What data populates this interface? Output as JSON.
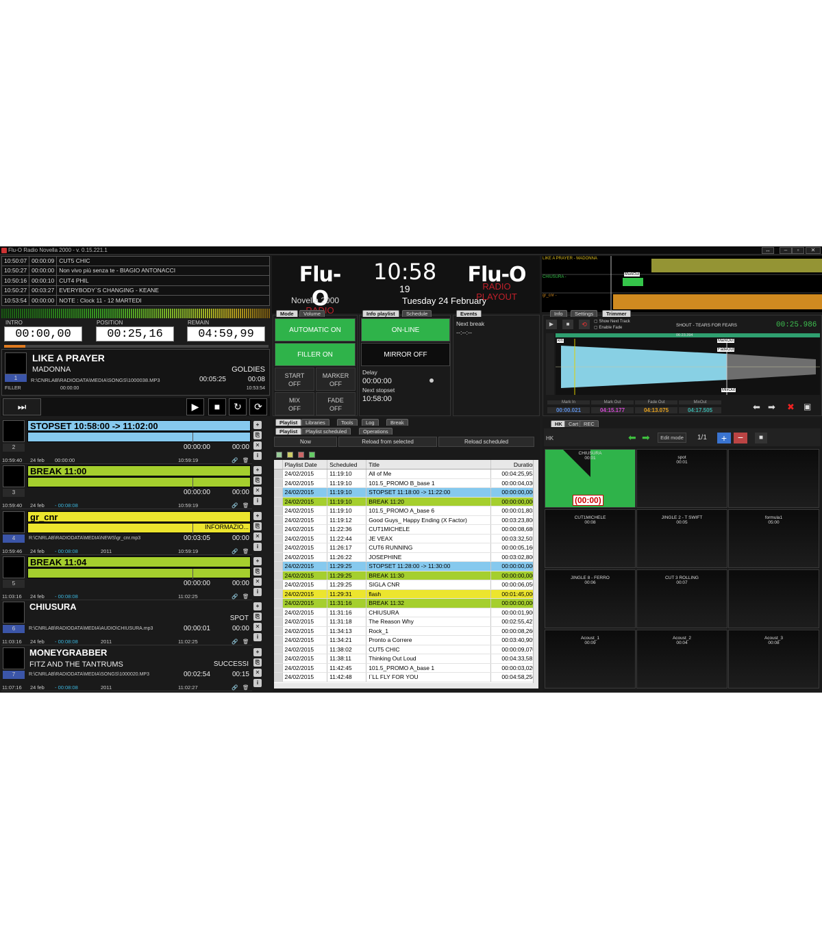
{
  "window": {
    "title": "Flu-O Radio Novella 2000 - v. 0.15.221.1"
  },
  "history": [
    {
      "time": "10:50:07",
      "dur": "00:00:09",
      "title": "CUT5 CHIC"
    },
    {
      "time": "10:50:27",
      "dur": "00:00:00",
      "title": "Non vivo più senza te - BIAGIO ANTONACCI"
    },
    {
      "time": "10:50:16",
      "dur": "00:00:10",
      "title": "CUT4 PHIL"
    },
    {
      "time": "10:50:27",
      "dur": "00:03:27",
      "title": "EVERYBODY`S CHANGING - KEANE"
    },
    {
      "time": "10:53:54",
      "dur": "00:00:00",
      "title": "NOTE : Clock 11 - 12   MARTEDI"
    }
  ],
  "counters": {
    "intro_label": "INTRO",
    "intro": "00:00,00",
    "position_label": "POSITION",
    "position": "00:25,16",
    "remain_label": "REMAIN",
    "remain": "04:59,99",
    "progress": 0.08
  },
  "current": {
    "title": "LIKE A PRAYER",
    "artist": "MADONNA",
    "category": "GOLDIES",
    "num": "1",
    "path": "R:\\CNRLAB\\RADIODATA\\MEDIA\\SONGS\\1000038.MP3",
    "duration": "00:05:25",
    "intro": "00:08",
    "type": "FILLER",
    "time1": "00:00:00",
    "time2": "10:53:54"
  },
  "queue": [
    {
      "num": "2",
      "title": "STOPSET 10:58:00 -> 11:02:00",
      "color": "#86c9ee",
      "bar": "#86c9ee",
      "dur": "00:00:00",
      "intro": "00:00",
      "path": "",
      "cat": "",
      "foot_time": "10:59:40",
      "foot_date": "24 feb",
      "foot_dur": "00:00:00",
      "foot_year": "",
      "foot_end": "10:59:19"
    },
    {
      "num": "3",
      "title": "BREAK 11:00",
      "color": "#a5cf2e",
      "bar": "#a5cf2e",
      "dur": "00:00:00",
      "intro": "00:00",
      "path": "",
      "cat": "",
      "foot_time": "10:59:40",
      "foot_date": "24 feb",
      "foot_dur": "- 00:08:08",
      "foot_year": "",
      "foot_end": "10:59:19"
    },
    {
      "num": "4",
      "title": "gr_cnr",
      "color": "#ece52e",
      "bar": "#ece52e",
      "dur": "00:03:05",
      "intro": "00:00",
      "path": "R:\\CNRLAB\\RADIODATA\\MEDIA\\NEWS\\gr_cnr.mp3",
      "cat": "INFORMAZIO...",
      "foot_time": "10:59:46",
      "foot_date": "24 feb",
      "foot_dur": "- 00:08:08",
      "foot_year": "2011",
      "foot_end": "10:59:19"
    },
    {
      "num": "5",
      "title": "BREAK 11:04",
      "color": "#a5cf2e",
      "bar": "#a5cf2e",
      "dur": "00:00:00",
      "intro": "00:00",
      "path": "",
      "cat": "",
      "foot_time": "11:03:16",
      "foot_date": "24 feb",
      "foot_dur": "- 00:08:08",
      "foot_year": "",
      "foot_end": "11:02:25"
    },
    {
      "num": "6",
      "title": "CHIUSURA",
      "color": "",
      "bar": "",
      "dur": "00:00:01",
      "intro": "00:00",
      "path": "R:\\CNRLAB\\RADIODATA\\MEDIA\\AUDIO\\CHIUSURA.mp3",
      "cat": "SPOT",
      "foot_time": "11:03:16",
      "foot_date": "24 feb",
      "foot_dur": "- 00:08:08",
      "foot_year": "2011",
      "foot_end": "11:02:25"
    },
    {
      "num": "7",
      "title": "MONEYGRABBER",
      "artist": "FITZ AND THE TANTRUMS",
      "color": "",
      "bar": "",
      "dur": "00:02:54",
      "intro": "00:15",
      "path": "R:\\CNRLAB\\RADIODATA\\MEDIA\\SONGS\\1000020.MP3",
      "cat": "SUCCESSI",
      "foot_time": "11:07:16",
      "foot_date": "24 feb",
      "foot_dur": "- 00:08:08",
      "foot_year": "2011",
      "foot_end": "11:02:27"
    }
  ],
  "header": {
    "logo": "Flu-O",
    "logo_sub": "RADIO PLAYOUT",
    "station": "Novella 2000",
    "clock": "10:58",
    "seconds": "19",
    "date": "Tuesday 24  February"
  },
  "mode": {
    "tabs": [
      "Mode",
      "Volume"
    ],
    "automatic": "AUTOMATIC ON",
    "filler": "FILLER ON",
    "start": "START",
    "start_state": "OFF",
    "marker": "MARKER",
    "marker_state": "OFF",
    "mix": "MIX",
    "mix_state": "OFF",
    "fade": "FADE",
    "fade_state": "OFF"
  },
  "info": {
    "tabs": [
      "Info playlist",
      "Schedule"
    ],
    "online": "ON-LINE",
    "mirror": "MIRROR OFF",
    "delay_label": "Delay",
    "delay": "00:00:00",
    "next_label": "Next stopset",
    "next": "10:58:00"
  },
  "events": {
    "tab": "Events",
    "next_break": "Next break",
    "value": "--:--:--"
  },
  "wave_top": {
    "l1": "LIKE A PRAYER - MADONNA",
    "l2": "CHIUSURA -",
    "l3": "gr_cnr -",
    "mark": "MarkOut"
  },
  "trimmer": {
    "tabs": [
      "Info",
      "Settings",
      "Trimmer"
    ],
    "opt1": "Show Next Track",
    "opt2": "Enable Fade",
    "track": "SHOUT - TEARS FOR FEARS",
    "time": "00:25.986",
    "mid_time": "06:23.394",
    "kin": "kIn",
    "markout": "MarkOut",
    "fadeout": "FadeOut",
    "mixout": "MixOut",
    "marks": [
      {
        "label": "Mark In",
        "value": "00:00.021",
        "color": "#5b8de0"
      },
      {
        "label": "Mark Out",
        "value": "04:15.177",
        "color": "#d04ad0"
      },
      {
        "label": "Fade Out",
        "value": "04:13.075",
        "color": "#e6a21e"
      },
      {
        "label": "MixOut",
        "value": "04:17.505",
        "color": "#39b0a8"
      }
    ]
  },
  "lists": {
    "tabs": [
      "Playlist",
      "Libraries",
      "Tools",
      "Log",
      "Break"
    ],
    "subtabs": [
      "Playlist",
      "Playlist scheduled",
      "Operations"
    ],
    "now": "Now",
    "reload_sel": "Reload from selected",
    "reload_sch": "Reload scheduled",
    "cols": [
      "Playlist Date",
      "Scheduled",
      "Title",
      "Duration"
    ],
    "rows": [
      [
        "24/02/2015",
        "11:19:10",
        "All of Me",
        "00:04:25,953",
        ""
      ],
      [
        "24/02/2015",
        "11:19:10",
        "101.5_PROMO B_base 1",
        "00:00:04,030",
        ""
      ],
      [
        "24/02/2015",
        "11:19:10",
        "STOPSET 11:18:00 -> 11:22:00",
        "00:00:00,000",
        "#86c9ee"
      ],
      [
        "24/02/2015",
        "11:19:10",
        "BREAK 11:20",
        "00:00:00,000",
        "#a5cf2e"
      ],
      [
        "24/02/2015",
        "11:19:10",
        "101.5_PROMO A_base 6",
        "00:00:01,803",
        ""
      ],
      [
        "24/02/2015",
        "11:19:12",
        "Good Guys_ Happy Ending (X Factor)",
        "00:03:23,800",
        ""
      ],
      [
        "24/02/2015",
        "11:22:36",
        "CUT1MICHELE",
        "00:00:08,680",
        ""
      ],
      [
        "24/02/2015",
        "11:22:44",
        "JE VEAX",
        "00:03:32,507",
        ""
      ],
      [
        "24/02/2015",
        "11:26:17",
        "CUT6 RUNNING",
        "00:00:05,160",
        ""
      ],
      [
        "24/02/2015",
        "11:26:22",
        "JOSEPHINE",
        "00:03:02,800",
        ""
      ],
      [
        "24/02/2015",
        "11:29:25",
        "STOPSET 11:28:00 -> 11:30:00",
        "00:00:00,000",
        "#86c9ee"
      ],
      [
        "24/02/2015",
        "11:29:25",
        "BREAK 11:30",
        "00:00:00,000",
        "#a5cf2e"
      ],
      [
        "24/02/2015",
        "11:29:25",
        "SIGLA CNR",
        "00:00:06,050",
        ""
      ],
      [
        "24/02/2015",
        "11:29:31",
        "flash",
        "00:01:45,000",
        "#ece52e"
      ],
      [
        "24/02/2015",
        "11:31:16",
        "BREAK 11:32",
        "00:00:00,000",
        "#a5cf2e"
      ],
      [
        "24/02/2015",
        "11:31:16",
        "CHIUSURA",
        "00:00:01,900",
        ""
      ],
      [
        "24/02/2015",
        "11:31:18",
        "The Reason Why",
        "00:02:55,427",
        ""
      ],
      [
        "24/02/2015",
        "11:34:13",
        "Rock_1",
        "00:00:08,260",
        ""
      ],
      [
        "24/02/2015",
        "11:34:21",
        "Pronto a Correre",
        "00:03:40,909",
        ""
      ],
      [
        "24/02/2015",
        "11:38:02",
        "CUT5 CHIC",
        "00:00:09,070",
        ""
      ],
      [
        "24/02/2015",
        "11:38:11",
        "Thinking Out Loud",
        "00:04:33,581",
        ""
      ],
      [
        "24/02/2015",
        "11:42:45",
        "101.5_PROMO A_base 1",
        "00:00:03,020",
        ""
      ],
      [
        "24/02/2015",
        "11:42:48",
        "I`LL FLY FOR YOU",
        "00:04:58,256",
        ""
      ]
    ]
  },
  "carts": {
    "tabs": [
      "HK",
      "Cart",
      "REC"
    ],
    "label": "HK",
    "edit": "Edit mode",
    "page": "1/1",
    "items": [
      {
        "name": "CHIUSURA",
        "time": "00:01",
        "active": true,
        "countdown": "(00:00)"
      },
      {
        "name": "spot",
        "time": "00:01"
      },
      {
        "name": "",
        "time": ""
      },
      {
        "name": "CUT1MICHELE",
        "time": "00:08"
      },
      {
        "name": "JINGLE 2 - T SWIFT",
        "time": "00:05"
      },
      {
        "name": "formula1",
        "time": "05:00"
      },
      {
        "name": "JINGLE 8 - FERRO",
        "time": "00:06"
      },
      {
        "name": "CUT 3 ROLLING",
        "time": "00:07"
      },
      {
        "name": "",
        "time": ""
      },
      {
        "name": "Acoust_1",
        "time": "00:09"
      },
      {
        "name": "Acoust_2",
        "time": "00:04"
      },
      {
        "name": "Acoust_3",
        "time": "00:08"
      }
    ]
  },
  "colors": {
    "accent_green": "#2fb34a",
    "stopset": "#86c9ee",
    "break": "#a5cf2e",
    "news": "#ece52e",
    "logo_red": "#c0202a"
  }
}
